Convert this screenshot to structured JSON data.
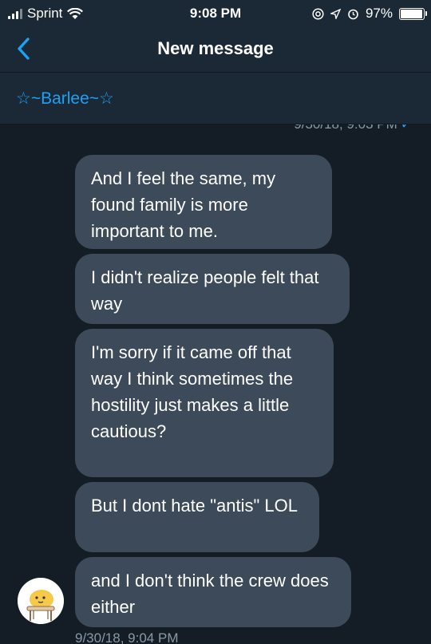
{
  "status_bar": {
    "carrier": "Sprint",
    "time": "9:08 PM",
    "battery": "97%",
    "battery_level": 0.97
  },
  "nav": {
    "title": "New message"
  },
  "recipient": {
    "name": "☆~Barlee~☆"
  },
  "thread": {
    "timestamp_top": "9/30/18, 9:03 PM",
    "messages": [
      "And I feel the same, my found family is more important to me.",
      "I didn't realize people felt that way",
      "I'm sorry if it came off that way I think sometimes the hostility just makes a little cautious?",
      "But I dont hate \"antis\" LOL",
      "and I don't think the crew does either"
    ],
    "timestamp_bottom": "9/30/18, 9:04 PM"
  },
  "colors": {
    "background": "#141d26",
    "bar": "#1b2836",
    "bubble": "#3c4a5a",
    "accent": "#1da1f2",
    "muted": "#8899a6"
  }
}
